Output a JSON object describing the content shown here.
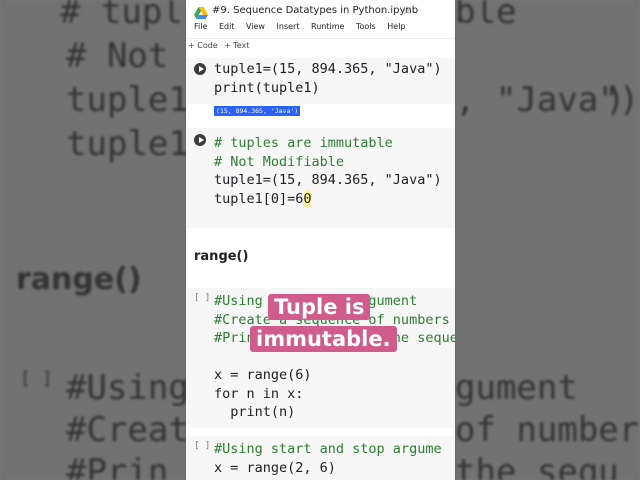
{
  "background": {
    "left_lines": [
      "# tupl",
      "# Not",
      "tuple1",
      "tuple1",
      "range()",
      "[ ]",
      "#Using",
      "#Create",
      "#Prin"
    ],
    "right_lines": [
      "ble",
      ")",
      ",  \"Java\")",
      "gument",
      "of number",
      "the sequ"
    ]
  },
  "notebook": {
    "title": "#9. Sequence Datatypes in Python.ipynb",
    "menu": [
      "File",
      "Edit",
      "View",
      "Insert",
      "Runtime",
      "Tools",
      "Help"
    ],
    "toolbar": {
      "code": "+ Code",
      "text": "+ Text"
    }
  },
  "cells": {
    "c1_l1": "tuple1=(15, 894.365, \"Java\")",
    "c1_l2": "print(tuple1)",
    "c1_output": "(15, 894.365, 'Java')",
    "c2_l1": "# tuples are immutable",
    "c2_l2": "# Not Modifiable",
    "c2_l3": "tuple1=(15, 894.365, \"Java\")",
    "c2_l4a": "tuple1[0]=6",
    "c2_l4b": "0",
    "section": "range()",
    "c3_bracket": "[ ]",
    "c3_l1": "#Using only stop argument",
    "c3_l2": "#Create a sequence of numbers",
    "c3_l3": "#Print all values of the sequence",
    "c3_l4": "x = range(6)",
    "c3_l5": "for n in x:",
    "c3_l6": "  print(n)",
    "c4_bracket": "[ ]",
    "c4_l1": "#Using start and stop argume",
    "c4_l2": "x = range(2, 6)"
  },
  "caption": {
    "line1": "Tuple is",
    "line2": "immutable."
  },
  "colors": {
    "caption": "#d05c8a",
    "comment": "#2e7d32",
    "number": "#1565c0",
    "string": "#a31515"
  }
}
